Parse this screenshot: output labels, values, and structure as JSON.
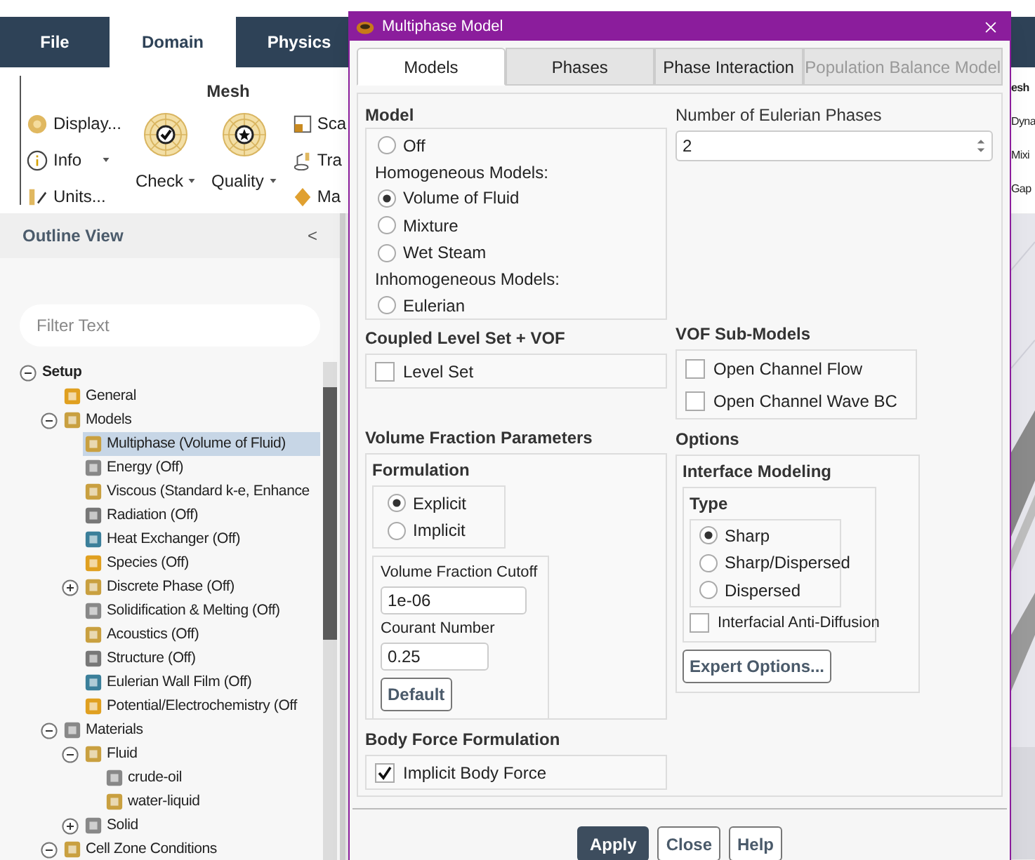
{
  "app": {
    "ribbon_tabs": [
      {
        "label": "File",
        "selected": false
      },
      {
        "label": "Domain",
        "selected": true
      },
      {
        "label": "Physics",
        "selected": false
      }
    ],
    "ribbon_group_title": "Mesh",
    "ribbon_small_items": [
      {
        "label": "Display...",
        "kind": "display",
        "dropdown": false
      },
      {
        "label": "Info",
        "kind": "info",
        "dropdown": true
      },
      {
        "label": "Units...",
        "kind": "units",
        "dropdown": false
      }
    ],
    "ribbon_large_items": [
      {
        "label": "Check",
        "kind": "check",
        "dropdown": true
      },
      {
        "label": "Quality",
        "kind": "quality",
        "dropdown": true
      }
    ],
    "ribbon_cut_items": [
      {
        "label": "Sca",
        "kind": "scale"
      },
      {
        "label": "Tra",
        "kind": "transform"
      },
      {
        "label": "Ma",
        "kind": "make"
      }
    ],
    "right_ribbon": {
      "group_title": "esh",
      "items": [
        "Dyna",
        "Mixi",
        "Gap"
      ]
    },
    "outline_view": {
      "title": "Outline View",
      "collapse": "<"
    },
    "filter": {
      "placeholder": "Filter Text"
    },
    "tree": [
      {
        "label": "Setup",
        "expanded": true,
        "selected": false,
        "children": [
          {
            "label": "General",
            "selected": false
          },
          {
            "label": "Models",
            "expanded": true,
            "selected": false,
            "children": [
              {
                "label": "Multiphase (Volume of Fluid)",
                "selected": true
              },
              {
                "label": "Energy (Off)",
                "selected": false
              },
              {
                "label": "Viscous (Standard k-e, Enhance",
                "selected": false
              },
              {
                "label": "Radiation (Off)",
                "selected": false
              },
              {
                "label": "Heat Exchanger (Off)",
                "selected": false
              },
              {
                "label": "Species (Off)",
                "selected": false
              },
              {
                "label": "Discrete Phase (Off)",
                "expanded": false,
                "selected": false
              },
              {
                "label": "Solidification & Melting (Off)",
                "selected": false
              },
              {
                "label": "Acoustics (Off)",
                "selected": false
              },
              {
                "label": "Structure (Off)",
                "selected": false
              },
              {
                "label": "Eulerian Wall Film (Off)",
                "selected": false
              },
              {
                "label": "Potential/Electrochemistry (Off",
                "selected": false
              }
            ]
          },
          {
            "label": "Materials",
            "expanded": true,
            "selected": false,
            "children": [
              {
                "label": "Fluid",
                "expanded": true,
                "selected": false,
                "children": [
                  {
                    "label": "crude-oil",
                    "selected": false
                  },
                  {
                    "label": "water-liquid",
                    "selected": false
                  }
                ]
              },
              {
                "label": "Solid",
                "expanded": false,
                "selected": false
              }
            ]
          },
          {
            "label": "Cell Zone Conditions",
            "expanded": true,
            "selected": false
          }
        ]
      }
    ]
  },
  "dialog": {
    "title": "Multiphase Model",
    "tabs": [
      {
        "label": "Models",
        "selected": true,
        "disabled": false
      },
      {
        "label": "Phases",
        "selected": false,
        "disabled": false
      },
      {
        "label": "Phase Interaction",
        "selected": false,
        "disabled": false
      },
      {
        "label": "Population Balance Model",
        "selected": false,
        "disabled": true
      }
    ],
    "model": {
      "title": "Model",
      "options": [
        {
          "kind": "radio",
          "label": "Off",
          "selected": false
        },
        {
          "kind": "heading",
          "label": "Homogeneous Models:"
        },
        {
          "kind": "radio",
          "label": "Volume of Fluid",
          "selected": true
        },
        {
          "kind": "radio",
          "label": "Mixture",
          "selected": false
        },
        {
          "kind": "radio",
          "label": "Wet Steam",
          "selected": false
        },
        {
          "kind": "heading",
          "label": "Inhomogeneous Models:"
        },
        {
          "kind": "radio",
          "label": "Eulerian",
          "selected": false
        }
      ]
    },
    "eulerian_phases": {
      "label": "Number of Eulerian Phases",
      "value": "2"
    },
    "coupled_level_set": {
      "title": "Coupled Level Set + VOF",
      "options": [
        {
          "label": "Level Set",
          "checked": false
        }
      ]
    },
    "vof_sub_models": {
      "title": "VOF Sub-Models",
      "options": [
        {
          "label": "Open Channel Flow",
          "checked": false
        },
        {
          "label": "Open Channel Wave BC",
          "checked": false
        }
      ]
    },
    "volume_fraction_parameters": {
      "title": "Volume Fraction Parameters",
      "formulation": {
        "title": "Formulation",
        "options": [
          {
            "label": "Explicit",
            "selected": true
          },
          {
            "label": "Implicit",
            "selected": false
          }
        ]
      },
      "fields": [
        {
          "label": "Volume Fraction Cutoff",
          "value": "1e-06"
        },
        {
          "label": "Courant Number",
          "value": "0.25"
        }
      ],
      "default_button": "Default"
    },
    "options": {
      "title": "Options",
      "interface_modeling": {
        "title": "Interface Modeling",
        "type_title": "Type",
        "types": [
          {
            "label": "Sharp",
            "selected": true
          },
          {
            "label": "Sharp/Dispersed",
            "selected": false
          },
          {
            "label": "Dispersed",
            "selected": false
          }
        ],
        "anti_diffusion": {
          "label": "Interfacial Anti-Diffusion",
          "checked": false
        }
      },
      "expert_button": "Expert Options..."
    },
    "body_force": {
      "title": "Body Force Formulation",
      "options": [
        {
          "label": "Implicit Body Force",
          "checked": true
        }
      ]
    },
    "buttons": [
      {
        "label": "Apply",
        "kind": "primary"
      },
      {
        "label": "Close",
        "kind": "normal"
      },
      {
        "label": "Help",
        "kind": "normal"
      }
    ]
  }
}
